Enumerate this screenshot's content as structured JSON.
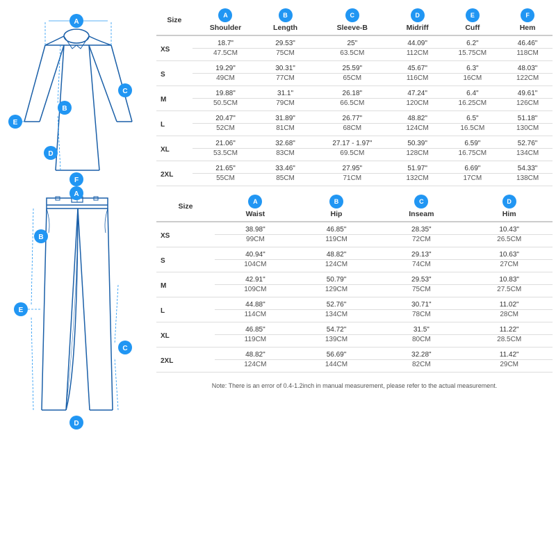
{
  "diagram": {
    "labels": [
      "A",
      "B",
      "C",
      "D",
      "E",
      "F"
    ]
  },
  "top_table": {
    "columns": [
      {
        "id": "size",
        "label": "Size"
      },
      {
        "id": "A",
        "label": "A",
        "sublabel": "Shoulder"
      },
      {
        "id": "B",
        "label": "B",
        "sublabel": "Length"
      },
      {
        "id": "C",
        "label": "C",
        "sublabel": "Sleeve-B"
      },
      {
        "id": "D",
        "label": "D",
        "sublabel": "Midriff"
      },
      {
        "id": "E",
        "label": "E",
        "sublabel": "Cuff"
      },
      {
        "id": "F",
        "label": "F",
        "sublabel": "Hem"
      }
    ],
    "rows": [
      {
        "size": "XS",
        "A1": "18.7\"",
        "A2": "47.5CM",
        "B1": "29.53\"",
        "B2": "75CM",
        "C1": "25\"",
        "C2": "63.5CM",
        "D1": "44.09\"",
        "D2": "112CM",
        "E1": "6.2\"",
        "E2": "15.75CM",
        "F1": "46.46\"",
        "F2": "118CM"
      },
      {
        "size": "S",
        "A1": "19.29\"",
        "A2": "49CM",
        "B1": "30.31\"",
        "B2": "77CM",
        "C1": "25.59\"",
        "C2": "65CM",
        "D1": "45.67\"",
        "D2": "116CM",
        "E1": "6.3\"",
        "E2": "16CM",
        "F1": "48.03\"",
        "F2": "122CM"
      },
      {
        "size": "M",
        "A1": "19.88\"",
        "A2": "50.5CM",
        "B1": "31.1\"",
        "B2": "79CM",
        "C1": "26.18\"",
        "C2": "66.5CM",
        "D1": "47.24\"",
        "D2": "120CM",
        "E1": "6.4\"",
        "E2": "16.25CM",
        "F1": "49.61\"",
        "F2": "126CM"
      },
      {
        "size": "L",
        "A1": "20.47\"",
        "A2": "52CM",
        "B1": "31.89\"",
        "B2": "81CM",
        "C1": "26.77\"",
        "C2": "68CM",
        "D1": "48.82\"",
        "D2": "124CM",
        "E1": "6.5\"",
        "E2": "16.5CM",
        "F1": "51.18\"",
        "F2": "130CM"
      },
      {
        "size": "XL",
        "A1": "21.06\"",
        "A2": "53.5CM",
        "B1": "32.68\"",
        "B2": "83CM",
        "C1": "27.17 - 1.97\"",
        "C2": "69.5CM",
        "D1": "50.39\"",
        "D2": "128CM",
        "E1": "6.59\"",
        "E2": "16.75CM",
        "F1": "52.76\"",
        "F2": "134CM"
      },
      {
        "size": "2XL",
        "A1": "21.65\"",
        "A2": "55CM",
        "B1": "33.46\"",
        "B2": "85CM",
        "C1": "27.95\"",
        "C2": "71CM",
        "D1": "51.97\"",
        "D2": "132CM",
        "E1": "6.69\"",
        "E2": "17CM",
        "F1": "54.33\"",
        "F2": "138CM"
      }
    ]
  },
  "bottom_table": {
    "columns": [
      {
        "id": "size",
        "label": "Size"
      },
      {
        "id": "A",
        "label": "A",
        "sublabel": "Waist"
      },
      {
        "id": "B",
        "label": "B",
        "sublabel": "Hip"
      },
      {
        "id": "C",
        "label": "C",
        "sublabel": "Inseam"
      },
      {
        "id": "D",
        "label": "D",
        "sublabel": "Him"
      }
    ],
    "rows": [
      {
        "size": "XS",
        "A1": "38.98\"",
        "A2": "99CM",
        "B1": "46.85\"",
        "B2": "119CM",
        "C1": "28.35\"",
        "C2": "72CM",
        "D1": "10.43\"",
        "D2": "26.5CM"
      },
      {
        "size": "S",
        "A1": "40.94\"",
        "A2": "104CM",
        "B1": "48.82\"",
        "B2": "124CM",
        "C1": "29.13\"",
        "C2": "74CM",
        "D1": "10.63\"",
        "D2": "27CM"
      },
      {
        "size": "M",
        "A1": "42.91\"",
        "A2": "109CM",
        "B1": "50.79\"",
        "B2": "129CM",
        "C1": "29.53\"",
        "C2": "75CM",
        "D1": "10.83\"",
        "D2": "27.5CM"
      },
      {
        "size": "L",
        "A1": "44.88\"",
        "A2": "114CM",
        "B1": "52.76\"",
        "B2": "134CM",
        "C1": "30.71\"",
        "C2": "78CM",
        "D1": "11.02\"",
        "D2": "28CM"
      },
      {
        "size": "XL",
        "A1": "46.85\"",
        "A2": "119CM",
        "B1": "54.72\"",
        "B2": "139CM",
        "C1": "31.5\"",
        "C2": "80CM",
        "D1": "11.22\"",
        "D2": "28.5CM"
      },
      {
        "size": "2XL",
        "A1": "48.82\"",
        "A2": "124CM",
        "B1": "56.69\"",
        "B2": "144CM",
        "C1": "32.28\"",
        "C2": "82CM",
        "D1": "11.42\"",
        "D2": "29CM"
      }
    ]
  },
  "note": "Note: There is an error of 0.4-1.2inch in manual measurement, please refer to the actual measurement.",
  "colors": {
    "circle_bg": "#2196F3",
    "circle_text": "#ffffff",
    "border": "#cccccc"
  }
}
